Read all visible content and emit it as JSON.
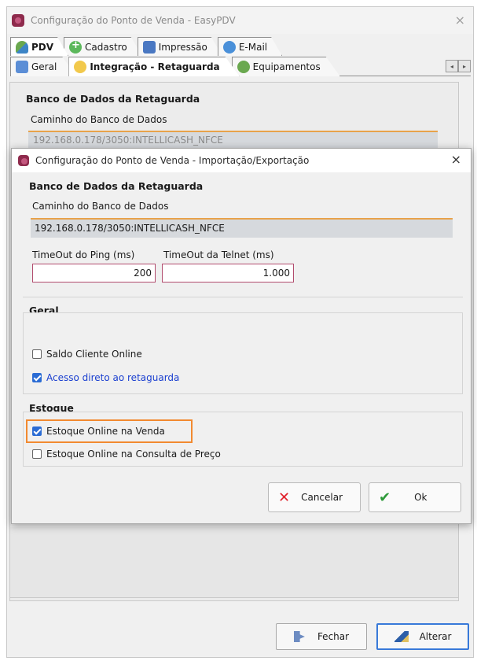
{
  "window": {
    "title": "Configuração do Ponto de Venda - EasyPDV",
    "close_glyph": "×"
  },
  "tabs_top": [
    {
      "label": "PDV",
      "icon": "pdv-icon",
      "active": true
    },
    {
      "label": "Cadastro",
      "icon": "plus-icon",
      "active": false
    },
    {
      "label": "Impressão",
      "icon": "printer-icon",
      "active": false
    },
    {
      "label": "E-Mail",
      "icon": "email-icon",
      "active": false
    }
  ],
  "tabs_sub": [
    {
      "label": "Geral",
      "icon": "grid-icon",
      "active": false
    },
    {
      "label": "Integração - Retaguarda",
      "icon": "sync-icon",
      "active": true
    },
    {
      "label": "Equipamentos",
      "icon": "equipment-icon",
      "active": false
    }
  ],
  "scroll": {
    "left": "◂",
    "right": "▸"
  },
  "background_panel": {
    "group_title": "Banco de Dados da Retaguarda",
    "path_label": "Caminho do Banco de Dados",
    "path_value": "192.168.0.178/3050:INTELLICASH_NFCE"
  },
  "bottom_buttons": {
    "fechar": "Fechar",
    "alterar": "Alterar"
  },
  "dialog": {
    "title": "Configuração do Ponto de Venda - Importação/Exportação",
    "close_glyph": "×",
    "db_group_title": "Banco de Dados da Retaguarda",
    "path_label": "Caminho do Banco de Dados",
    "path_value": "192.168.0.178/3050:INTELLICASH_NFCE",
    "ping_label": "TimeOut do Ping (ms)",
    "ping_value": "200",
    "telnet_label": "TimeOut da Telnet (ms)",
    "telnet_value": "1.000",
    "geral_title": "Geral",
    "saldo_label": "Saldo Cliente Online",
    "saldo_checked": false,
    "acesso_label": "Acesso direto ao retaguarda",
    "acesso_checked": true,
    "estoque_title": "Estoque",
    "estoque_venda_label": "Estoque Online na Venda",
    "estoque_venda_checked": true,
    "estoque_consulta_label": "Estoque Online na Consulta de Preço",
    "estoque_consulta_checked": false,
    "cancel_label": "Cancelar",
    "ok_label": "Ok"
  },
  "colors": {
    "highlight": "#f28a30",
    "accent_border": "#b24c6e",
    "checkbox_blue": "#2b6cd4"
  }
}
